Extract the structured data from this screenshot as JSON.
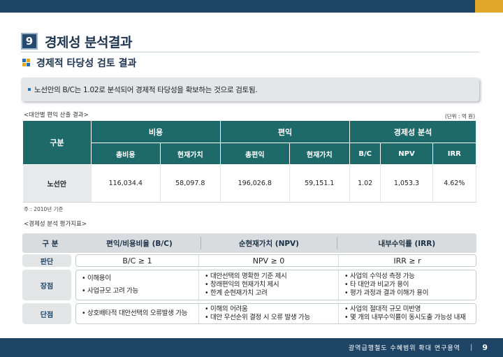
{
  "section": {
    "number": "9",
    "title": "경제성 분석결과"
  },
  "subtitle": "경제적 타당성 검토 결과",
  "summary": "노선안의 B/C는 1.02로 분석되어 경제적 타당성을 확보하는 것으로 검토됨.",
  "table1": {
    "caption": "<대안별 편익 산출 결과>",
    "unit": "(단위 : 억 원)",
    "gubun": "구분",
    "groups": {
      "cost": "비용",
      "benefit": "편익",
      "econ": "경제성 분석"
    },
    "columns": [
      "총비용",
      "현재가치",
      "총편익",
      "현재가치",
      "B/C",
      "NPV",
      "IRR"
    ],
    "rows": [
      {
        "name": "노선안",
        "values": [
          "116,034.4",
          "58,097.8",
          "196,026.8",
          "59,151.1",
          "1.02",
          "1,053.3",
          "4.62%"
        ]
      }
    ]
  },
  "note": "주 : 2010년 기준",
  "table2": {
    "caption": "<경제성 분석 평가지표>",
    "headers": [
      "구 분",
      "편익/비용비율 (B/C)",
      "순현재가치 (NPV)",
      "내부수익률 (IRR)"
    ],
    "judge": {
      "label": "판단",
      "values": [
        "B/C ≥ 1",
        "NPV ≥ 0",
        "IRR ≥ r"
      ]
    },
    "pros": {
      "label": "장점",
      "a": [
        "• 이해용이",
        "• 사업규모 고려 가능"
      ],
      "b": [
        "• 대안선택의 명확한 기준 제시",
        "• 창래편익의 현재가치 제시",
        "• 한계 순현재가치 고려"
      ],
      "c": [
        "• 사업의 수익성 측정 가능",
        "• 타 대안과 비교가 용이",
        "• 평가 과정과 결과 이해가 용이"
      ]
    },
    "cons": {
      "label": "단점",
      "a": [
        "• 상호배타적 대안선택의 오류발생 가능"
      ],
      "b": [
        "• 이해의 어려움",
        "• 대안 우선순위 결정 시 오류 발생 가능"
      ],
      "c": [
        "• 사업의 절대적 규모 미반영",
        "• 몇 개의 내부수익률이 동시도출 가능성 내재"
      ]
    }
  },
  "footer": {
    "text": "광역급행철도 수혜범위 확대 연구용역",
    "separator": "|",
    "page": "9"
  },
  "colors": {
    "navy": "#1f4566",
    "teal": "#1e6a6b",
    "gold": "#e0a82a"
  }
}
